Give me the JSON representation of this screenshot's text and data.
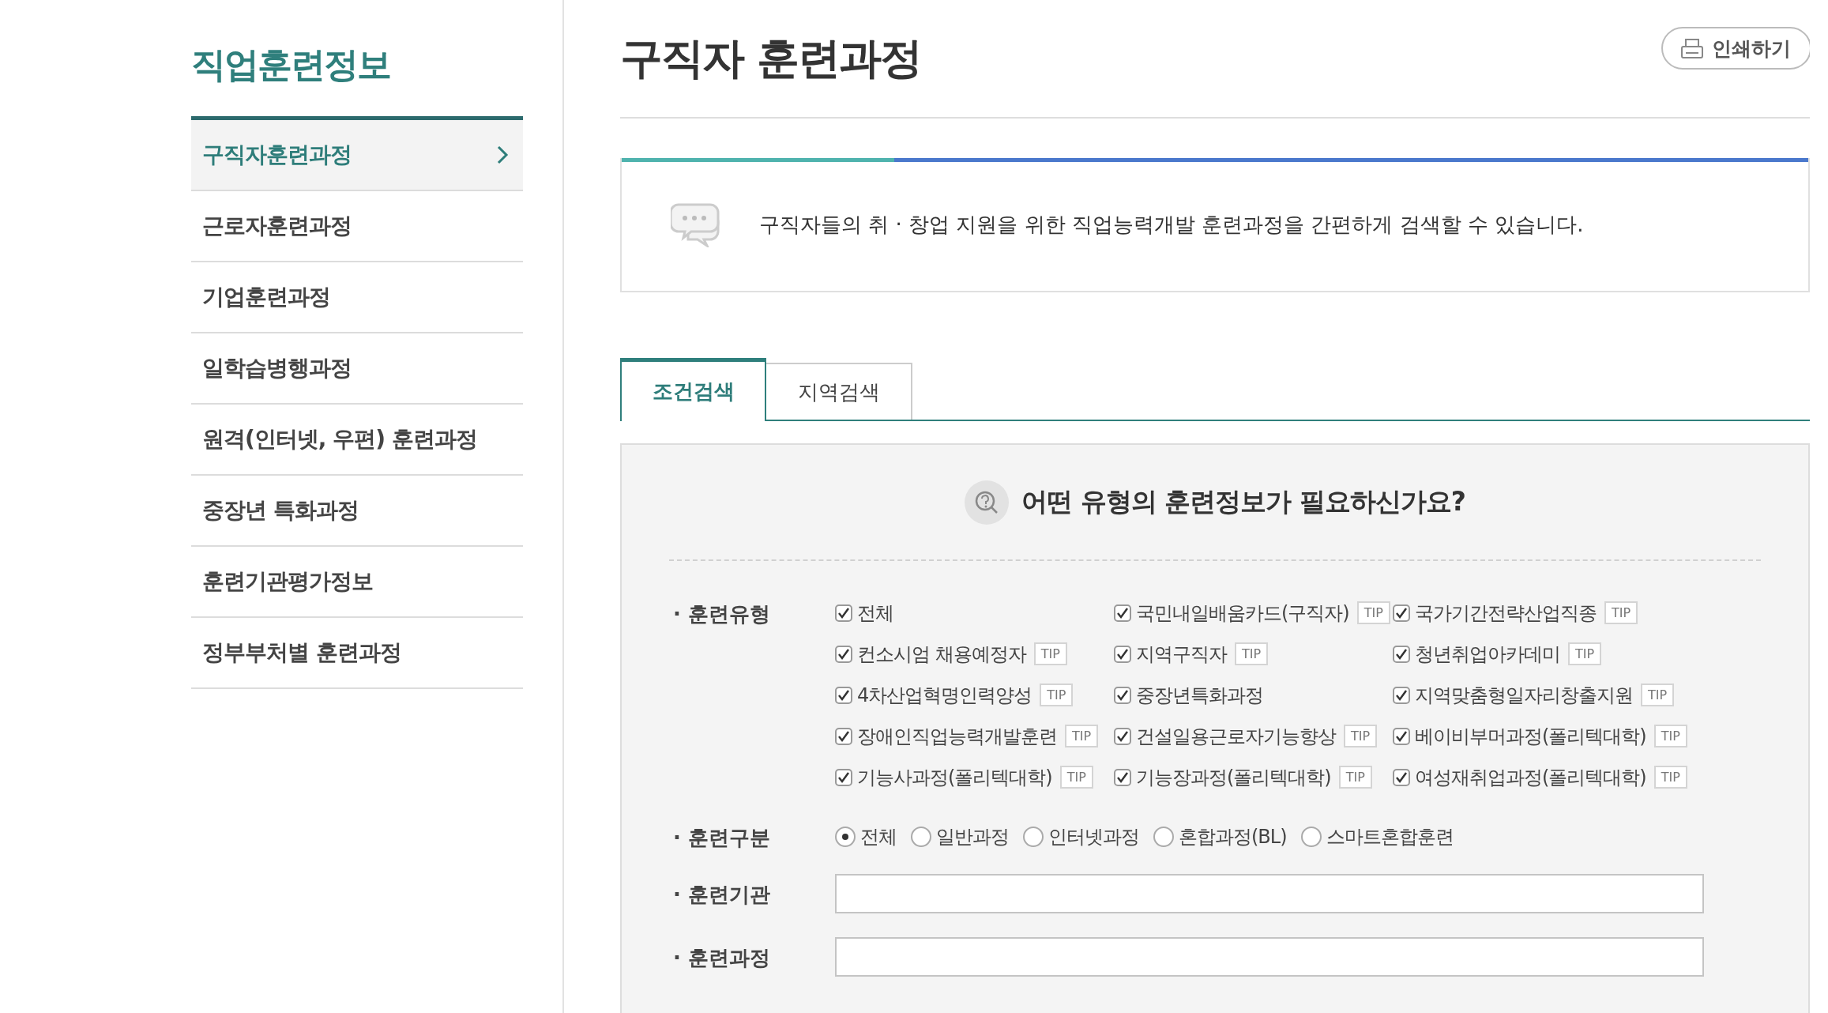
{
  "sidebar": {
    "title": "직업훈련정보",
    "items": [
      {
        "label": "구직자훈련과정",
        "selected": true
      },
      {
        "label": "근로자훈련과정",
        "selected": false
      },
      {
        "label": "기업훈련과정",
        "selected": false
      },
      {
        "label": "일학습병행과정",
        "selected": false
      },
      {
        "label": "원격(인터넷, 우편) 훈련과정",
        "selected": false
      },
      {
        "label": "중장년 특화과정",
        "selected": false
      },
      {
        "label": "훈련기관평가정보",
        "selected": false
      },
      {
        "label": "정부부처별 훈련과정",
        "selected": false
      }
    ]
  },
  "page": {
    "title": "구직자 훈련과정",
    "print_button": "인쇄하기"
  },
  "info": {
    "text": "구직자들의 취 · 창업 지원을 위한 직업능력개발 훈련과정을 간편하게 검색할 수 있습니다."
  },
  "tabs": [
    {
      "label": "조건검색",
      "selected": true
    },
    {
      "label": "지역검색",
      "selected": false
    }
  ],
  "search": {
    "heading": "어떤 유형의 훈련정보가 필요하신가요?",
    "training_type": {
      "label": "· 훈련유형",
      "options": [
        {
          "label": "전체",
          "checked": true
        },
        {
          "label": "국민내일배움카드(구직자)",
          "checked": true,
          "tip": "TIP"
        },
        {
          "label": "국가기간전략산업직종",
          "checked": true,
          "tip": "TIP"
        },
        {
          "label": "컨소시엄 채용예정자",
          "checked": true,
          "tip": "TIP"
        },
        {
          "label": "지역구직자",
          "checked": true,
          "tip": "TIP"
        },
        {
          "label": "청년취업아카데미",
          "checked": true,
          "tip": "TIP"
        },
        {
          "label": "4차산업혁명인력양성",
          "checked": true,
          "tip": "TIP"
        },
        {
          "label": "중장년특화과정",
          "checked": true
        },
        {
          "label": "지역맞춤형일자리창출지원",
          "checked": true,
          "tip": "TIP"
        },
        {
          "label": "장애인직업능력개발훈련",
          "checked": true,
          "tip": "TIP"
        },
        {
          "label": "건설일용근로자기능향상",
          "checked": true,
          "tip": "TIP"
        },
        {
          "label": "베이비부머과정(폴리텍대학)",
          "checked": true,
          "tip": "TIP"
        },
        {
          "label": "기능사과정(폴리텍대학)",
          "checked": true,
          "tip": "TIP"
        },
        {
          "label": "기능장과정(폴리텍대학)",
          "checked": true,
          "tip": "TIP"
        },
        {
          "label": "여성재취업과정(폴리텍대학)",
          "checked": true,
          "tip": "TIP"
        }
      ]
    },
    "training_category": {
      "label": "· 훈련구분",
      "options": [
        {
          "label": "전체",
          "selected": true
        },
        {
          "label": "일반과정",
          "selected": false
        },
        {
          "label": "인터넷과정",
          "selected": false
        },
        {
          "label": "혼합과정(BL)",
          "selected": false
        },
        {
          "label": "스마트혼합훈련",
          "selected": false
        }
      ]
    },
    "fields": [
      {
        "label": "· 훈련기관"
      },
      {
        "label": "· 훈련과정"
      }
    ]
  }
}
